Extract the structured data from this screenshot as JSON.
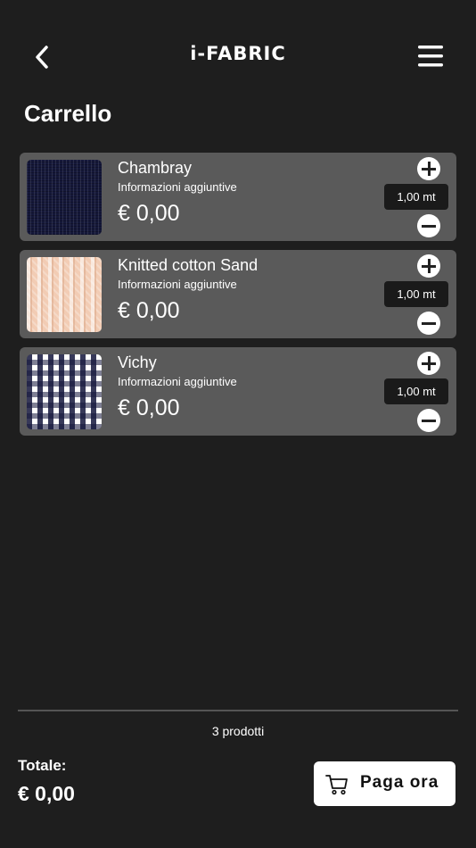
{
  "header": {
    "logo": "i-FABRIC"
  },
  "page": {
    "title": "Carrello"
  },
  "cart": {
    "items": [
      {
        "name": "Chambray",
        "info": "Informazioni aggiuntive",
        "price": "€ 0,00",
        "quantity": "1,00 mt"
      },
      {
        "name": "Knitted cotton Sand",
        "info": "Informazioni aggiuntive",
        "price": "€ 0,00",
        "quantity": "1,00 mt"
      },
      {
        "name": "Vichy",
        "info": "Informazioni aggiuntive",
        "price": "€ 0,00",
        "quantity": "1,00 mt"
      }
    ]
  },
  "footer": {
    "product_count": "3 prodotti",
    "total_label": "Totale:",
    "total_value": "€ 0,00",
    "pay_label": "Paga ora"
  },
  "icons": {
    "back": "chevron-left-icon",
    "menu": "hamburger-menu-icon",
    "increase": "plus-circle-icon",
    "decrease": "minus-circle-icon",
    "cart": "shopping-cart-icon"
  },
  "colors": {
    "background": "#1e1e1e",
    "card": "#5a5a5a",
    "quantity_box": "#1a1a1a",
    "button": "#ffffff"
  }
}
